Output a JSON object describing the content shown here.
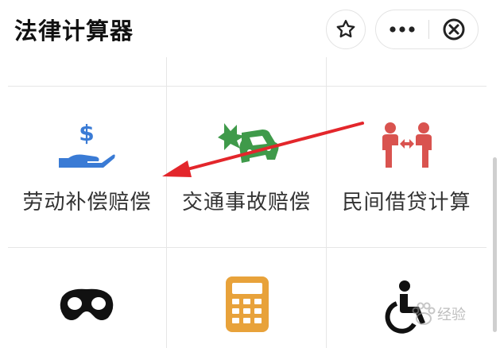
{
  "header": {
    "title": "法律计算器",
    "star_icon": "star-icon",
    "more_icon": "more-dots-icon",
    "close_icon": "close-circle-icon"
  },
  "grid": {
    "row1": [
      {
        "label": "劳动补偿赔偿",
        "icon": "hand-dollar-icon",
        "color": "#3a7bd5"
      },
      {
        "label": "交通事故赔偿",
        "icon": "car-crash-icon",
        "color": "#3f9a4a"
      },
      {
        "label": "民间借贷计算",
        "icon": "people-exchange-icon",
        "color": "#d9534f"
      }
    ],
    "row2": [
      {
        "icon": "mask-icon",
        "color": "#111111"
      },
      {
        "icon": "calculator-icon",
        "color": "#e8a23a"
      },
      {
        "icon": "wheelchair-icon",
        "color": "#111111"
      }
    ]
  },
  "watermark": {
    "text": "经验",
    "icon": "paw-icon"
  }
}
